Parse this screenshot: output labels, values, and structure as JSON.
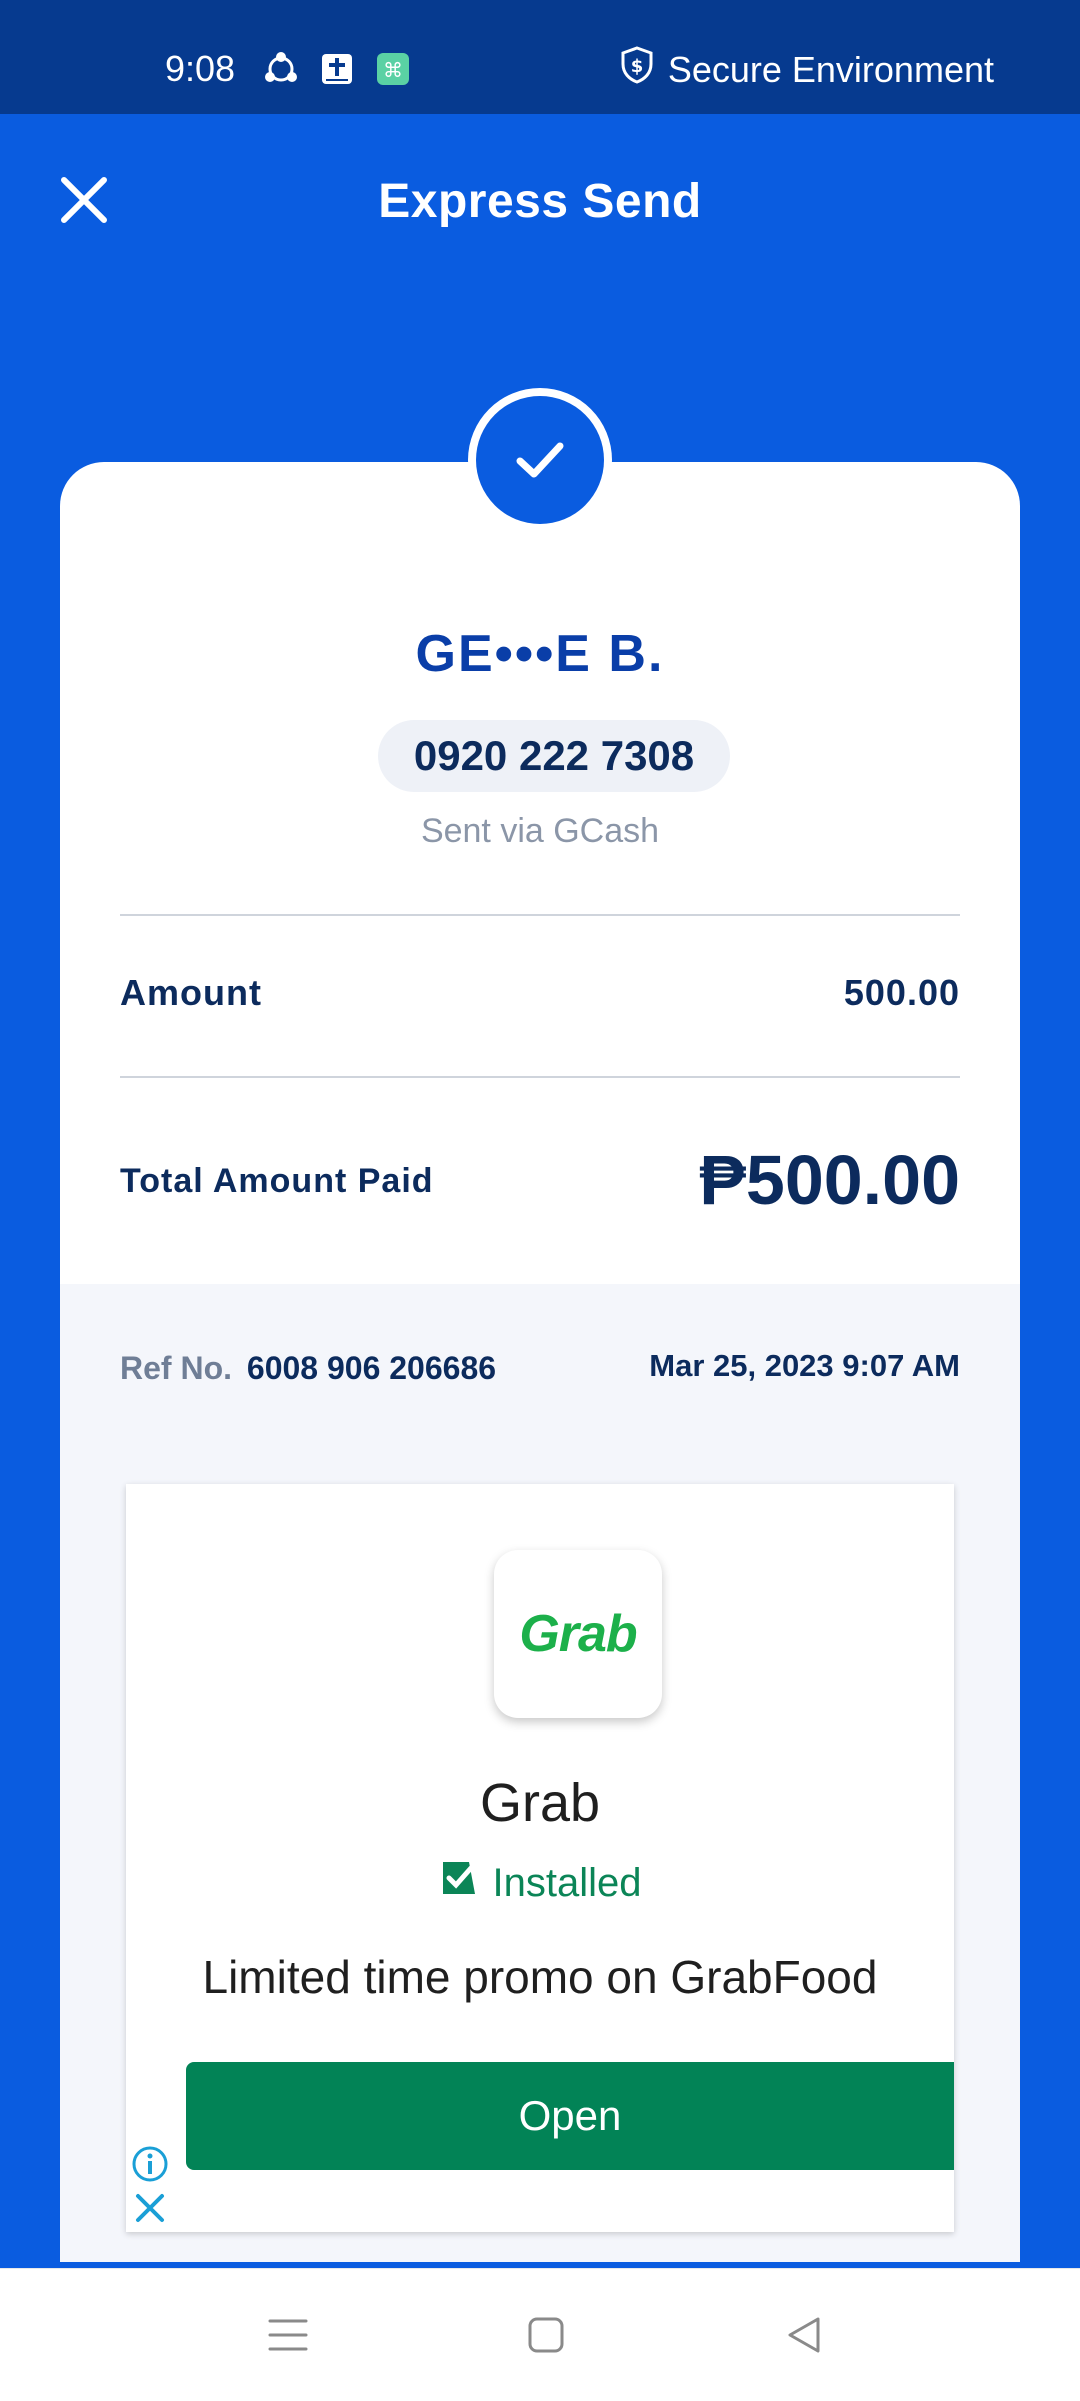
{
  "status_bar": {
    "time": "9:08",
    "secure_label": "Secure Environment",
    "icons": [
      "share-icon",
      "bible-icon",
      "notification-icon",
      "shield-dollar-icon"
    ]
  },
  "header": {
    "title": "Express Send",
    "close_icon": "close-icon"
  },
  "receipt": {
    "recipient_name": "GE•••E B.",
    "phone_number": "0920 222 7308",
    "sent_via": "Sent via GCash",
    "amount_label": "Amount",
    "amount_value": "500.00",
    "total_label": "Total Amount Paid",
    "total_value": "₱500.00",
    "ref_label": "Ref No.",
    "ref_number": "6008 906 206686",
    "date_time": "Mar 25, 2023 9:07 AM"
  },
  "ad": {
    "app_logo_text": "Grab",
    "app_name": "Grab",
    "installed_label": "Installed",
    "promo_text": "Limited time promo on GrabFood",
    "open_label": "Open",
    "icons": [
      "info-icon",
      "close-icon"
    ]
  },
  "nav_bar": {
    "icons": [
      "menu-icon",
      "home-square-icon",
      "back-triangle-icon"
    ]
  },
  "colors": {
    "primary_blue": "#0a5ce0",
    "status_bar": "#063a8f",
    "text_dark": "#0c2b5d",
    "open_button": "#028356",
    "installed_green": "#0b8557",
    "grab_green": "#1cb04a"
  }
}
